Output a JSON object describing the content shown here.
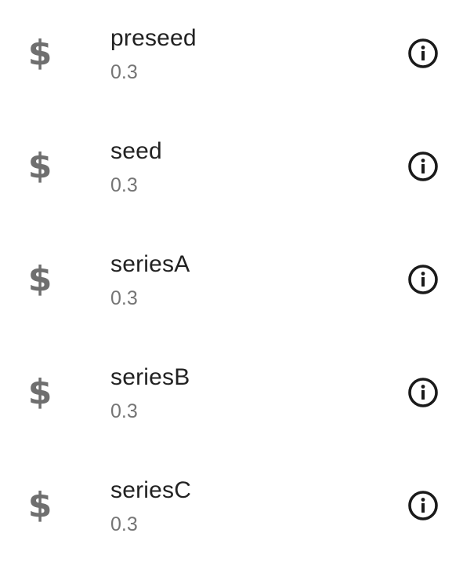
{
  "items": [
    {
      "label": "preseed",
      "value": "0.3",
      "icon": "dollar-icon",
      "action_icon": "info-icon"
    },
    {
      "label": "seed",
      "value": "0.3",
      "icon": "dollar-icon",
      "action_icon": "info-icon"
    },
    {
      "label": "seriesA",
      "value": "0.3",
      "icon": "dollar-icon",
      "action_icon": "info-icon"
    },
    {
      "label": "seriesB",
      "value": "0.3",
      "icon": "dollar-icon",
      "action_icon": "info-icon"
    },
    {
      "label": "seriesC",
      "value": "0.3",
      "icon": "dollar-icon",
      "action_icon": "info-icon"
    }
  ],
  "colors": {
    "icon": "#6f6f6f",
    "primary_text": "#222222",
    "secondary_text": "#757575",
    "info_icon": "#1a1a1a"
  }
}
